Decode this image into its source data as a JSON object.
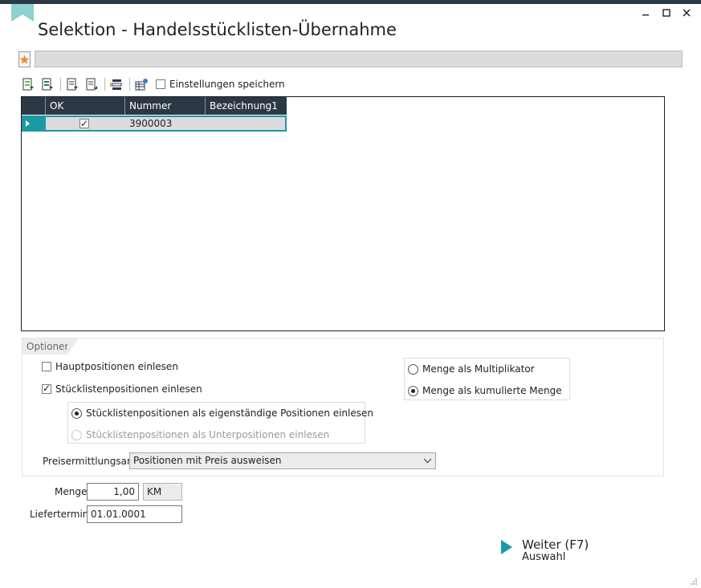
{
  "window": {
    "title": "Selektion - Handelsstücklisten-Übernahme",
    "minimize_icon": "minimize-icon",
    "maximize_icon": "maximize-icon",
    "close_icon": "close-icon"
  },
  "toolbar": {
    "save_settings_label": "Einstellungen speichern",
    "save_settings_checked": false
  },
  "grid": {
    "columns": [
      "OK",
      "Nummer",
      "Bezeichnung1"
    ],
    "rows": [
      {
        "ok": true,
        "nummer": "3900003",
        "bezeichnung1": ""
      }
    ]
  },
  "options": {
    "section_label": "Optionen",
    "hauptpositionen": {
      "label": "Hauptpositionen einlesen",
      "checked": false
    },
    "stuecklistenpositionen": {
      "label": "Stücklistenpositionen einlesen",
      "checked": true
    },
    "radio_eigenstaendig": {
      "label": "Stücklistenpositionen als eigenständige Positionen einlesen",
      "selected": true
    },
    "radio_unterpositionen": {
      "label": "Stücklistenpositionen als Unterpositionen einlesen",
      "selected": false,
      "disabled": true
    },
    "menge_multiplikator": {
      "label": "Menge als Multiplikator",
      "selected": false
    },
    "menge_kumuliert": {
      "label": "Menge als kumulierte Menge",
      "selected": true
    },
    "preisermittlung_label": "Preisermittlungsart",
    "preisermittlung_value": "Positionen mit Preis ausweisen"
  },
  "menge": {
    "label": "Menge",
    "value": "1,00",
    "unit": "KM"
  },
  "liefertermin": {
    "label": "Liefertermin",
    "value": "01.01.0001"
  },
  "weiter": {
    "label": "Weiter (F7)",
    "sublabel": "Auswahl"
  },
  "colors": {
    "accent": "#1b9aa4",
    "header_bg": "#2d3846"
  }
}
